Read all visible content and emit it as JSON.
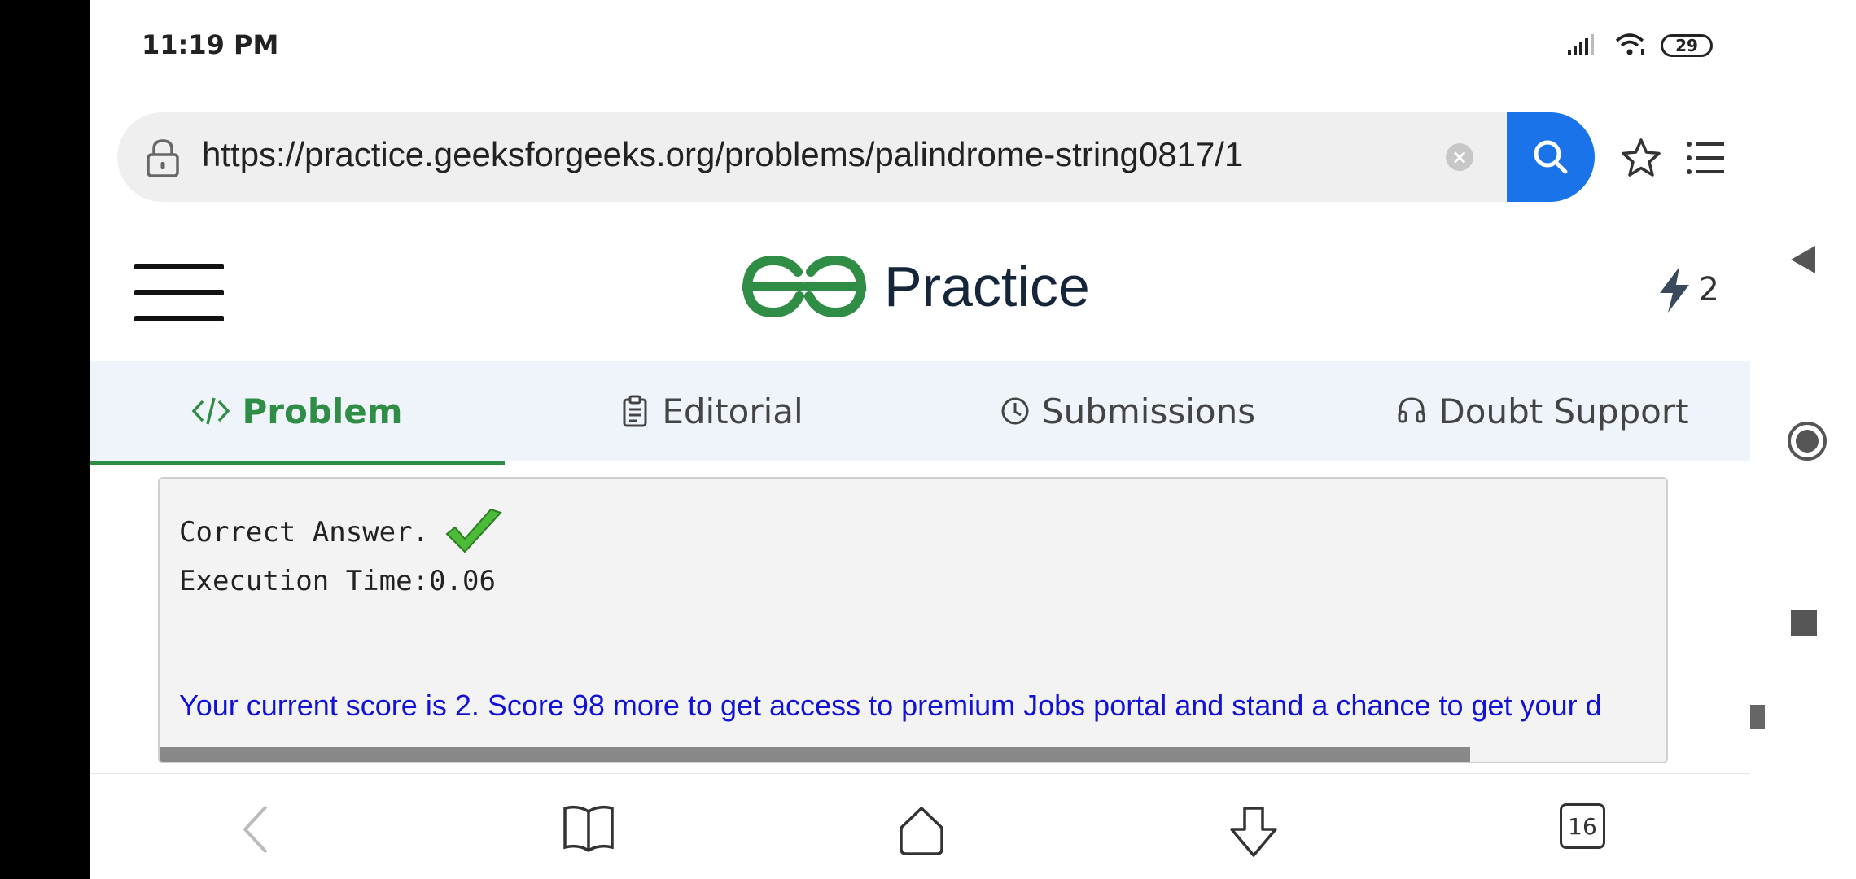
{
  "status_bar": {
    "time": "11:19 PM",
    "battery": "29",
    "icons": [
      "signal-icon",
      "wifi-icon",
      "battery-icon"
    ]
  },
  "browser": {
    "url": "https://practice.geeksforgeeks.org/problems/palindrome-string0817/1",
    "icons": [
      "lock-icon",
      "clear-icon",
      "search-icon",
      "star-icon",
      "list-menu-icon"
    ],
    "accent_color": "#1a73e8"
  },
  "site": {
    "logo_text": "Practice",
    "streak_count": "2",
    "brand_color": "#2f8d46"
  },
  "tabs": [
    {
      "label": "Problem",
      "icon": "code-icon",
      "active": true
    },
    {
      "label": "Editorial",
      "icon": "document-icon",
      "active": false
    },
    {
      "label": "Submissions",
      "icon": "clock-icon",
      "active": false
    },
    {
      "label": "Doubt Support",
      "icon": "headset-icon",
      "active": false
    }
  ],
  "result": {
    "status": "Correct Answer.",
    "execution": "Execution Time:0.06",
    "score_message": "Your current score is 2. Score 98 more to get access to premium Jobs portal and stand a chance to get your d"
  },
  "bottom_nav": {
    "tabs_count": "16",
    "icons": [
      "back-arrow-icon",
      "book-icon",
      "home-icon",
      "download-icon",
      "tabs-icon"
    ]
  }
}
